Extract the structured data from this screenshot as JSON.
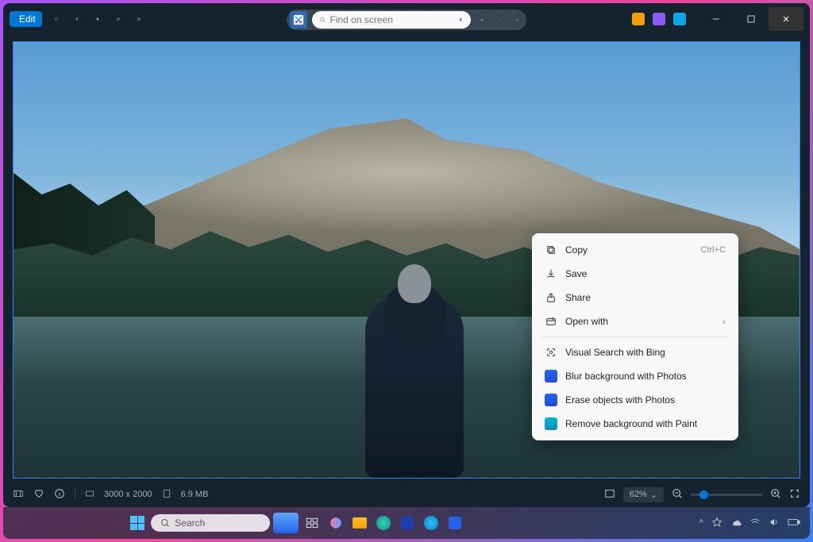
{
  "titlebar": {
    "edit_label": "Edit"
  },
  "search": {
    "placeholder": "Find on screen"
  },
  "context_menu": {
    "items": [
      {
        "label": "Copy",
        "shortcut": "Ctrl+C",
        "icon": "copy"
      },
      {
        "label": "Save",
        "icon": "save"
      },
      {
        "label": "Share",
        "icon": "share"
      },
      {
        "label": "Open with",
        "icon": "openwith",
        "submenu": true
      },
      {
        "label": "Visual Search with Bing",
        "icon": "visualsearch",
        "sep_before": true
      },
      {
        "label": "Blur background with Photos",
        "icon": "photos-blue"
      },
      {
        "label": "Erase objects with Photos",
        "icon": "photos-blue"
      },
      {
        "label": "Remove background with Paint",
        "icon": "paint"
      }
    ]
  },
  "statusbar": {
    "dimensions": "3000 x 2000",
    "filesize": "6.9 MB",
    "zoom": "62%"
  },
  "taskbar": {
    "search_placeholder": "Search"
  }
}
